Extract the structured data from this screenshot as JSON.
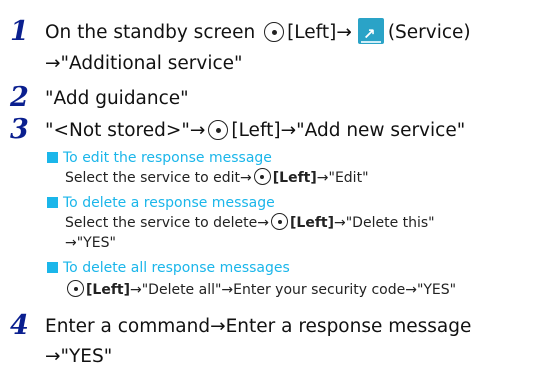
{
  "steps": [
    {
      "number": "1",
      "line1": {
        "pre": "On the standby screen",
        "key": "[Left]",
        "arrow": "→",
        "after": "(Service)"
      },
      "line2": "→\"Additional service\""
    },
    {
      "number": "2",
      "text": "\"Add guidance\""
    },
    {
      "number": "3",
      "line": {
        "pre": "\"<Not stored>\"→",
        "key": "[Left]",
        "post": "→\"Add new service\""
      },
      "subs": [
        {
          "heading": "To edit the response message",
          "pre": "Select the service to edit→",
          "key": "[Left]",
          "post": "→\"Edit\""
        },
        {
          "heading": "To delete a response message",
          "pre": "Select the service to delete→",
          "key": "[Left]",
          "post": "→\"Delete this\"",
          "line2": "→\"YES\""
        },
        {
          "heading": "To delete all response messages",
          "key": "[Left]",
          "post": "→\"Delete all\"→Enter your security code→\"YES\""
        }
      ]
    },
    {
      "number": "4",
      "line1": "Enter a command→Enter a response message",
      "line2": "→\"YES\""
    }
  ],
  "icons": {
    "select_key": "center-select-key-icon",
    "service": "service-menu-icon"
  },
  "colors": {
    "step_number": "#0a1f8f",
    "subheading": "#1bb6ea"
  }
}
